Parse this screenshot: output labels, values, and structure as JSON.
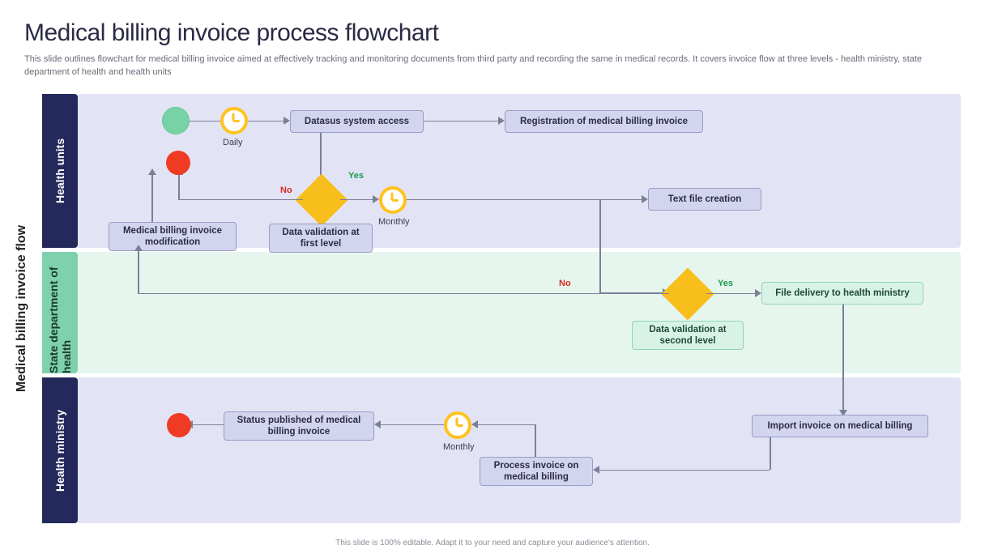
{
  "title": "Medical billing invoice process flowchart",
  "subtitle": "This slide outlines flowchart for medical billing invoice aimed at effectively tracking and monitoring documents from third party and recording the same in medical records. It covers invoice flow at three levels - health ministry, state department of health and health units",
  "master_lane_label": "Medical billing invoice flow",
  "lanes": {
    "health_units": "Health units",
    "state_dept": "State department of health",
    "health_ministry": "Health ministry"
  },
  "nodes": {
    "clock_daily": "Daily",
    "datasus_access": "Datasus system access",
    "registration": "Registration of medical billing invoice",
    "validation_first": "Data validation at first level",
    "clock_monthly1": "Monthly",
    "text_file": "Text file creation",
    "modification": "Medical billing invoice modification",
    "validation_second": "Data validation at second level",
    "file_delivery": "File delivery to health ministry",
    "import_invoice": "Import invoice on medical billing",
    "process_invoice": "Process invoice on medical billing",
    "clock_monthly2": "Monthly",
    "status_published": "Status published of medical billing invoice"
  },
  "labels": {
    "yes": "Yes",
    "no": "No"
  },
  "footer": "This slide is 100% editable. Adapt it to your need and capture your audience's attention."
}
